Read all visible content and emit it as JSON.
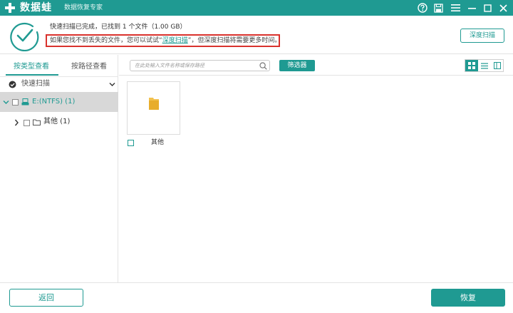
{
  "app": {
    "brand": "数据蛙",
    "subtitle": "数据恢复专家"
  },
  "header": {
    "status_text": "快速扫描已完成，已找到 1 个文件（1.00 GB）",
    "hint_prefix": "如果您找不到丢失的文件，您可以试试",
    "hint_link": "深度扫描",
    "hint_suffix": "，但深度扫描将需要更多时间。",
    "deep_scan_label": "深度扫描"
  },
  "sidebar": {
    "tabs": [
      {
        "label": "按类型查看",
        "active": true
      },
      {
        "label": "按路径查看",
        "active": false
      }
    ],
    "scan_mode": "快速扫描",
    "tree": [
      {
        "label": "E:(NTFS) (1)",
        "selected": true
      },
      {
        "label": "其他 (1)",
        "selected": false
      }
    ]
  },
  "toolbar": {
    "search_placeholder": "在此处输入文件名称或保存路径",
    "filter_label": "筛选器"
  },
  "files": [
    {
      "name": "其他",
      "icon": "folder-icon"
    }
  ],
  "footer": {
    "back_label": "返回",
    "recover_label": "恢复"
  },
  "colors": {
    "accent": "#1f9a92",
    "highlight_border": "#d9322d",
    "selected_row": "#d8d8d8",
    "folder": "#f2c14e"
  }
}
